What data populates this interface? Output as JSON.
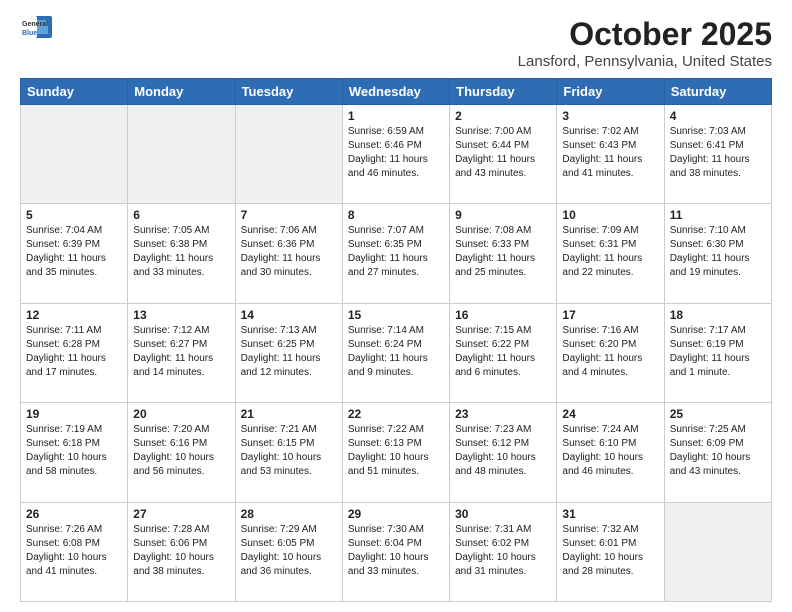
{
  "header": {
    "logo_general": "General",
    "logo_blue": "Blue",
    "title": "October 2025",
    "subtitle": "Lansford, Pennsylvania, United States"
  },
  "days_of_week": [
    "Sunday",
    "Monday",
    "Tuesday",
    "Wednesday",
    "Thursday",
    "Friday",
    "Saturday"
  ],
  "weeks": [
    [
      {
        "day": "",
        "text": ""
      },
      {
        "day": "",
        "text": ""
      },
      {
        "day": "",
        "text": ""
      },
      {
        "day": "1",
        "text": "Sunrise: 6:59 AM\nSunset: 6:46 PM\nDaylight: 11 hours and 46 minutes."
      },
      {
        "day": "2",
        "text": "Sunrise: 7:00 AM\nSunset: 6:44 PM\nDaylight: 11 hours and 43 minutes."
      },
      {
        "day": "3",
        "text": "Sunrise: 7:02 AM\nSunset: 6:43 PM\nDaylight: 11 hours and 41 minutes."
      },
      {
        "day": "4",
        "text": "Sunrise: 7:03 AM\nSunset: 6:41 PM\nDaylight: 11 hours and 38 minutes."
      }
    ],
    [
      {
        "day": "5",
        "text": "Sunrise: 7:04 AM\nSunset: 6:39 PM\nDaylight: 11 hours and 35 minutes."
      },
      {
        "day": "6",
        "text": "Sunrise: 7:05 AM\nSunset: 6:38 PM\nDaylight: 11 hours and 33 minutes."
      },
      {
        "day": "7",
        "text": "Sunrise: 7:06 AM\nSunset: 6:36 PM\nDaylight: 11 hours and 30 minutes."
      },
      {
        "day": "8",
        "text": "Sunrise: 7:07 AM\nSunset: 6:35 PM\nDaylight: 11 hours and 27 minutes."
      },
      {
        "day": "9",
        "text": "Sunrise: 7:08 AM\nSunset: 6:33 PM\nDaylight: 11 hours and 25 minutes."
      },
      {
        "day": "10",
        "text": "Sunrise: 7:09 AM\nSunset: 6:31 PM\nDaylight: 11 hours and 22 minutes."
      },
      {
        "day": "11",
        "text": "Sunrise: 7:10 AM\nSunset: 6:30 PM\nDaylight: 11 hours and 19 minutes."
      }
    ],
    [
      {
        "day": "12",
        "text": "Sunrise: 7:11 AM\nSunset: 6:28 PM\nDaylight: 11 hours and 17 minutes."
      },
      {
        "day": "13",
        "text": "Sunrise: 7:12 AM\nSunset: 6:27 PM\nDaylight: 11 hours and 14 minutes."
      },
      {
        "day": "14",
        "text": "Sunrise: 7:13 AM\nSunset: 6:25 PM\nDaylight: 11 hours and 12 minutes."
      },
      {
        "day": "15",
        "text": "Sunrise: 7:14 AM\nSunset: 6:24 PM\nDaylight: 11 hours and 9 minutes."
      },
      {
        "day": "16",
        "text": "Sunrise: 7:15 AM\nSunset: 6:22 PM\nDaylight: 11 hours and 6 minutes."
      },
      {
        "day": "17",
        "text": "Sunrise: 7:16 AM\nSunset: 6:20 PM\nDaylight: 11 hours and 4 minutes."
      },
      {
        "day": "18",
        "text": "Sunrise: 7:17 AM\nSunset: 6:19 PM\nDaylight: 11 hours and 1 minute."
      }
    ],
    [
      {
        "day": "19",
        "text": "Sunrise: 7:19 AM\nSunset: 6:18 PM\nDaylight: 10 hours and 58 minutes."
      },
      {
        "day": "20",
        "text": "Sunrise: 7:20 AM\nSunset: 6:16 PM\nDaylight: 10 hours and 56 minutes."
      },
      {
        "day": "21",
        "text": "Sunrise: 7:21 AM\nSunset: 6:15 PM\nDaylight: 10 hours and 53 minutes."
      },
      {
        "day": "22",
        "text": "Sunrise: 7:22 AM\nSunset: 6:13 PM\nDaylight: 10 hours and 51 minutes."
      },
      {
        "day": "23",
        "text": "Sunrise: 7:23 AM\nSunset: 6:12 PM\nDaylight: 10 hours and 48 minutes."
      },
      {
        "day": "24",
        "text": "Sunrise: 7:24 AM\nSunset: 6:10 PM\nDaylight: 10 hours and 46 minutes."
      },
      {
        "day": "25",
        "text": "Sunrise: 7:25 AM\nSunset: 6:09 PM\nDaylight: 10 hours and 43 minutes."
      }
    ],
    [
      {
        "day": "26",
        "text": "Sunrise: 7:26 AM\nSunset: 6:08 PM\nDaylight: 10 hours and 41 minutes."
      },
      {
        "day": "27",
        "text": "Sunrise: 7:28 AM\nSunset: 6:06 PM\nDaylight: 10 hours and 38 minutes."
      },
      {
        "day": "28",
        "text": "Sunrise: 7:29 AM\nSunset: 6:05 PM\nDaylight: 10 hours and 36 minutes."
      },
      {
        "day": "29",
        "text": "Sunrise: 7:30 AM\nSunset: 6:04 PM\nDaylight: 10 hours and 33 minutes."
      },
      {
        "day": "30",
        "text": "Sunrise: 7:31 AM\nSunset: 6:02 PM\nDaylight: 10 hours and 31 minutes."
      },
      {
        "day": "31",
        "text": "Sunrise: 7:32 AM\nSunset: 6:01 PM\nDaylight: 10 hours and 28 minutes."
      },
      {
        "day": "",
        "text": ""
      }
    ]
  ]
}
